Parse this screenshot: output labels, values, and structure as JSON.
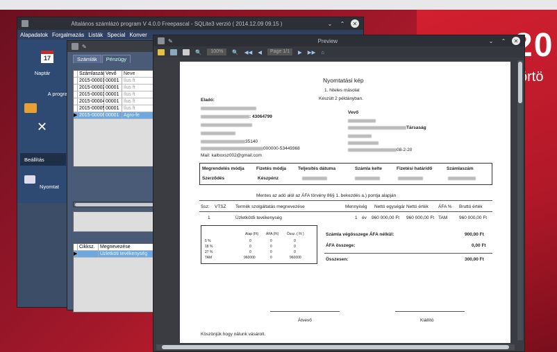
{
  "desktop": {
    "clock": "20:",
    "day": "örtö"
  },
  "main_window": {
    "title": "Általános számlázó program V 4.0.0 Freepascal - SQLite3 verzió ( 2014.12.09 09.15 )",
    "menu": [
      "Alapadatok",
      "Forgalmazás",
      "Listák",
      "Special",
      "Konver"
    ],
    "sidebar": {
      "calendar_day": "17",
      "calendar_label": "Naptár",
      "section": "A progra",
      "settings": "Beállítás",
      "print": "Nyomtat"
    }
  },
  "invoices_window": {
    "tabs": [
      "Számlák",
      "Pénzügy"
    ],
    "columns": [
      "Számlaszám",
      "Vevő",
      "Neve"
    ],
    "rows": [
      {
        "no": "2015-00001",
        "buyer": "00001",
        "name": "Ilus ft"
      },
      {
        "no": "2015-00002",
        "buyer": "00001",
        "name": "Ilus ft"
      },
      {
        "no": "2015-00003",
        "buyer": "00001",
        "name": "Ilus ft"
      },
      {
        "no": "2015-00004",
        "buyer": "00001",
        "name": "Ilus ft"
      },
      {
        "no": "2015-00005",
        "buyer": "00001",
        "name": "Ilus ft"
      },
      {
        "no": "2015-00006",
        "buyer": "00001",
        "name": "Agro-fe"
      }
    ],
    "items_columns": [
      "Cikksz.",
      "Megnevezése"
    ],
    "items": [
      {
        "code": "",
        "name": "Üzletköti tevékenység"
      }
    ]
  },
  "preview_window": {
    "title": "Preview",
    "zoom": "100%",
    "page": "Page 1/1"
  },
  "invoice": {
    "title": "Nyomtatási kép",
    "copy": "1. hiteles másolat",
    "copies": "Készült 2 példányban.",
    "seller_label": "Eladó:",
    "seller_tax": "43064799",
    "seller_zip": "35140",
    "seller_account": "000000-53449368",
    "seller_email": "kalboxsz002@gmail.com",
    "mail_label": "Mail:",
    "buyer_label": "Vevő",
    "buyer_company": "Társaság",
    "buyer_ref": "08-2-20",
    "header_cols": [
      "Megrendelés módja",
      "Fizetés módja",
      "Teljesítés dátuma",
      "Számla kelte",
      "Fizetési határidő",
      "Számlaszám"
    ],
    "header_vals": [
      "Szerződés",
      "Készpénz"
    ],
    "vat_note": "Mentes az adó alól az ÁFA törvény 86§ 1. bekezdés a.) pontja alapján",
    "item_cols": [
      "Ssz:",
      "VTSZ",
      "Termék szolgáltatás megnevezése",
      "Mennyiség",
      "Nettó egységár",
      "Nettó érték",
      "ÁFA %",
      "Bruttó érték"
    ],
    "item_row": {
      "no": "1",
      "name": "Üzletkötői tevékenység",
      "qty": "1",
      "unit": "év",
      "unit_price": "960 000,00 Ft",
      "net": "960 000,00 Ft",
      "vat": "TAM",
      "gross": "960 000,00 Ft"
    },
    "vat_table_cols": [
      "Alap (Ft)",
      "ÁFA (Ft)",
      "Össz. ( Ft )"
    ],
    "vat_table_rows": [
      {
        "rate": "5 %",
        "base": "0",
        "vat": "0",
        "total": "0"
      },
      {
        "rate": "18 %",
        "base": "0",
        "vat": "0",
        "total": "0"
      },
      {
        "rate": "27 %",
        "base": "0",
        "vat": "0",
        "total": "0"
      },
      {
        "rate": "TAM",
        "base": "960000",
        "vat": "0",
        "total": "960000"
      }
    ],
    "total_net_label": "Számla végösszege ÁFA nélkül:",
    "total_net": "900,00 Ft",
    "vat_total_label": "ÁFA összege:",
    "vat_total": "0,00 Ft",
    "grand_label": "Összesen:",
    "grand_total": "300,00 Ft",
    "signature_buyer": "Átvevő",
    "signature_seller": "Kiállító",
    "thanks": "Köszönjük hogy nálunk vásárolt."
  }
}
